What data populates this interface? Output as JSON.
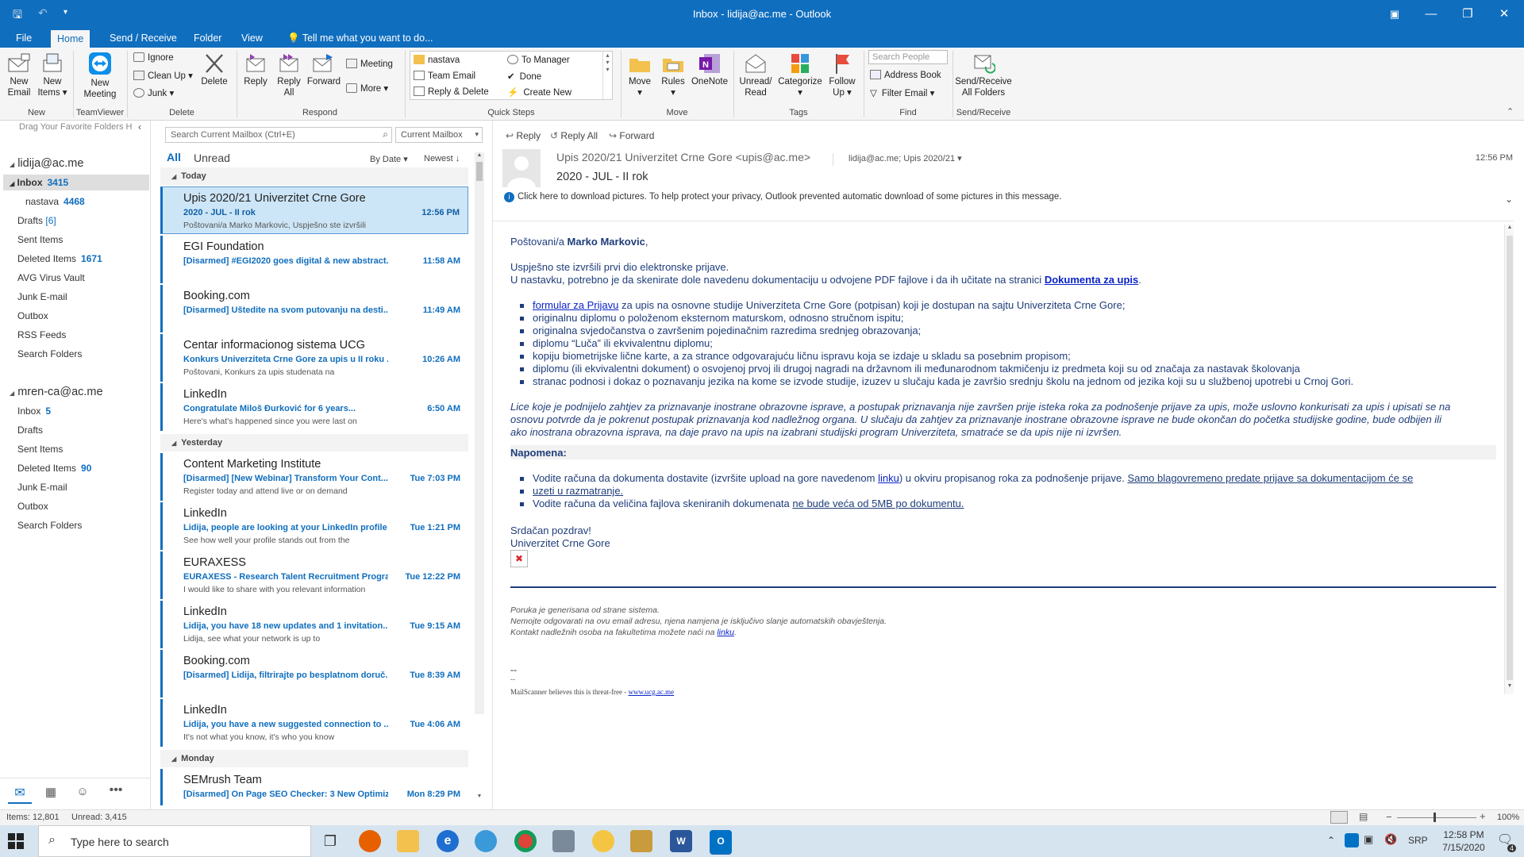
{
  "window": {
    "title": "Inbox - lidija@ac.me - Outlook"
  },
  "tabs": [
    {
      "label": "File"
    },
    {
      "label": "Home"
    },
    {
      "label": "Send / Receive"
    },
    {
      "label": "Folder"
    },
    {
      "label": "View"
    },
    {
      "label": "Tell me what you want to do..."
    }
  ],
  "ribbon": {
    "new_email": "New Email",
    "new_email_l1": "New",
    "new_email_l2": "Email",
    "new_items_l1": "New",
    "new_items_l2": "Items",
    "new_meeting_l1": "New",
    "new_meeting_l2": "Meeting",
    "group_new": "New",
    "group_teamviewer": "TeamViewer",
    "ignore": "Ignore",
    "clean_up": "Clean Up",
    "junk": "Junk",
    "delete": "Delete",
    "group_delete": "Delete",
    "reply": "Reply",
    "reply_all_l1": "Reply",
    "reply_all_l2": "All",
    "forward": "Forward",
    "meeting": "Meeting",
    "more": "More",
    "group_respond": "Respond",
    "qs_nastava": "nastava",
    "qs_team_email": "Team Email",
    "qs_reply_delete": "Reply & Delete",
    "qs_to_manager": "To Manager",
    "qs_done": "Done",
    "qs_create_new": "Create New",
    "group_quick_steps": "Quick Steps",
    "move": "Move",
    "rules": "Rules",
    "onenote": "OneNote",
    "group_move": "Move",
    "unread_l1": "Unread/",
    "unread_l2": "Read",
    "categorize": "Categorize",
    "follow_l1": "Follow",
    "follow_l2": "Up",
    "group_tags": "Tags",
    "search_people": "Search People",
    "address_book": "Address Book",
    "filter_email": "Filter Email",
    "group_find": "Find",
    "sr_l1": "Send/Receive",
    "sr_l2": "All Folders",
    "group_send_receive": "Send/Receive"
  },
  "nav": {
    "drag_hint": "Drag Your Favorite Folders H",
    "account1": "lidija@ac.me",
    "account1_folders": [
      {
        "name": "Inbox",
        "count": "3415"
      },
      {
        "name": "nastava",
        "count": "4468"
      },
      {
        "name": "Drafts",
        "count": "[6]"
      },
      {
        "name": "Sent Items",
        "count": ""
      },
      {
        "name": "Deleted Items",
        "count": "1671"
      },
      {
        "name": "AVG Virus Vault",
        "count": ""
      },
      {
        "name": "Junk E-mail",
        "count": ""
      },
      {
        "name": "Outbox",
        "count": ""
      },
      {
        "name": "RSS Feeds",
        "count": ""
      },
      {
        "name": "Search Folders",
        "count": ""
      }
    ],
    "account2": "mren-ca@ac.me",
    "account2_folders": [
      {
        "name": "Inbox",
        "count": "5"
      },
      {
        "name": "Drafts",
        "count": ""
      },
      {
        "name": "Sent Items",
        "count": ""
      },
      {
        "name": "Deleted Items",
        "count": "90"
      },
      {
        "name": "Junk E-mail",
        "count": ""
      },
      {
        "name": "Outbox",
        "count": ""
      },
      {
        "name": "Search Folders",
        "count": ""
      }
    ]
  },
  "list": {
    "search_placeholder": "Search Current Mailbox (Ctrl+E)",
    "scope": "Current Mailbox",
    "filter_all": "All",
    "filter_unread": "Unread",
    "sort_by": "By Date",
    "sort_order": "Newest",
    "group_today": "Today",
    "group_yesterday": "Yesterday",
    "group_monday": "Monday",
    "messages": [
      {
        "from": "Upis 2020/21 Univerzitet Crne Gore",
        "subject": "2020 - JUL - II rok",
        "time": "12:56 PM",
        "preview": "Poštovani/a Marko Markovic,  Uspješno ste izvršili"
      },
      {
        "from": "EGI Foundation",
        "subject": "[Disarmed] #EGI2020 goes digital & new abstract...",
        "time": "11:58 AM",
        "preview": ""
      },
      {
        "from": "Booking.com",
        "subject": "[Disarmed] Uštedite na svom putovanju na desti...",
        "time": "11:49 AM",
        "preview": ""
      },
      {
        "from": "Centar informacionog sistema UCG",
        "subject": "Konkurs Univerziteta Crne Gore za upis u II roku ...",
        "time": "10:26 AM",
        "preview": "Poštovani,   Konkurs za upis studenata na"
      },
      {
        "from": "LinkedIn",
        "subject": "Congratulate Miloš Đurković for 6 years...",
        "time": "6:50 AM",
        "preview": "Here's what's happened since you were last on"
      },
      {
        "from": "Content Marketing Institute",
        "subject": "[Disarmed] [New Webinar] Transform Your Cont...",
        "time": "Tue 7:03 PM",
        "preview": "Register today and attend live or on demand"
      },
      {
        "from": "LinkedIn",
        "subject": "Lidija, people are looking at your LinkedIn profile",
        "time": "Tue 1:21 PM",
        "preview": "See how well your profile stands out from the"
      },
      {
        "from": "EURAXESS",
        "subject": "EURAXESS - Research Talent Recruitment Progra...",
        "time": "Tue 12:22 PM",
        "preview": "I would like to share with you relevant information"
      },
      {
        "from": "LinkedIn",
        "subject": "Lidija, you have 18 new updates and 1 invitation...",
        "time": "Tue 9:15 AM",
        "preview": "Lidija, see what your network is up to"
      },
      {
        "from": "Booking.com",
        "subject": "[Disarmed] Lidija, filtrirajte po besplatnom doruč...",
        "time": "Tue 8:39 AM",
        "preview": ""
      },
      {
        "from": "LinkedIn",
        "subject": "Lidija, you have a new suggested connection to ...",
        "time": "Tue 4:06 AM",
        "preview": "It's not what you know, it's who you know"
      },
      {
        "from": "SEMrush Team",
        "subject": "[Disarmed] On Page SEO Checker: 3 New Optimiz...",
        "time": "Mon 8:29 PM",
        "preview": ""
      }
    ]
  },
  "reading": {
    "reply": "Reply",
    "reply_all": "Reply All",
    "forward": "Forward",
    "sender": "Upis 2020/21 Univerzitet Crne Gore <upis@ac.me>",
    "recipients": "lidija@ac.me; Upis 2020/21",
    "time": "12:56 PM",
    "subject": "2020 - JUL - II rok",
    "info_bar": "Click here to download pictures. To help protect your privacy, Outlook prevented automatic download of some pictures in this message.",
    "greeting_pre": "Poštovani/a ",
    "greeting_name": "Marko Markovic",
    "greeting_post": ",",
    "p1": "Uspješno ste izvršili prvi dio elektronske prijave.",
    "p2_pre": "U nastavku, potrebno je da skenirate dole navedenu dokumentaciju u odvojene PDF fajlove i da ih učitate na stranici ",
    "p2_link": "Dokumenta za upis",
    "p2_post": ".",
    "b1_link": "formular za Prijavu",
    "b1_text": " za upis na osnovne studije Univerziteta Crne Gore (potpisan) koji je dostupan na sajtu Univerziteta Crne Gore;",
    "b2": "originalnu diplomu o položenom eksternom maturskom, odnosno stručnom ispitu;",
    "b3": "originalna svjedočanstva o završenim pojedinačnim razredima srednjeg obrazovanja;",
    "b4": "diplomu “Luča” ili ekvivalentnu diplomu;",
    "b5": "kopiju biometrijske lične karte, a za strance odgovarajuću ličnu ispravu koja se izdaje u skladu sa posebnim propisom;",
    "b6": "diplomu (ili ekvivalentni dokument) o osvojenoj prvoj ili drugoj nagradi na državnom ili međunarodnom takmičenju iz predmeta koji su od značaja za nastavak školovanja",
    "b7": "stranac podnosi i dokaz o poznavanju jezika na kome se izvode studije, izuzev u slučaju kada je završio srednju školu na jednom od jezika koji su u službenoj upotrebi u Crnoj Gori.",
    "i1": "Lice koje je podnijelo zahtjev za priznavanje inostrane obrazovne isprave, a postupak priznavanja nije završen prije isteka roka za podnošenje prijave za upis, može uslovno konkurisati za upis i upisati se na",
    "i2": "osnovu potvrde da je pokrenut postupak priznavanja kod nadležnog organa. U slučaju da zahtjev za priznavanje inostrane obrazovne isprave ne bude okončan do početka studijske godine, bude odbijen ili",
    "i3": "ako inostrana obrazovna isprava, na daje pravo na upis na izabrani studijski program Univerziteta, smatraće se da upis nije ni izvršen.",
    "napomena": "Napomena:",
    "n1_pre": "Vodite računa da dokumenta dostavite (izvršite upload na gore navedenom ",
    "n1_link": "linku",
    "n1_mid": ") u okviru propisanog roka za podnošenje prijave. ",
    "n1_u1": "Samo blagovremeno predate prijave sa dokumentacijom će se",
    "n1_u2": "uzeti u razmatranje.",
    "n2_pre": "Vodite računa da veličina fajlova skeniranih dokumenata ",
    "n2_u": "ne bude veća od 5MB po dokumentu.",
    "closing1": "Srdačan pozdrav!",
    "closing2": "Univerzitet Crne Gore",
    "f1": "Poruka je generisana od strane sistema.",
    "f2": "Nemojte odgovarati na ovu email adresu, njena namjena je isključivo slanje automatskih obavještenja.",
    "f3_pre": "Kontakt nadležnih osoba na fakultetima možete naći na ",
    "f3_link": "linku",
    "f3_post": ".",
    "sig1": "--",
    "sig2": "--",
    "mailscanner_pre": "MailScanner believes this is threat-free - ",
    "mailscanner_link": "www.ucg.ac.me"
  },
  "status": {
    "items": "Items: 12,801",
    "unread": "Unread: 3,415",
    "zoom": "100%"
  },
  "taskbar": {
    "search_placeholder": "Type here to search",
    "lang": "SRP",
    "time": "12:58 PM",
    "date": "7/15/2020",
    "notif_count": "4"
  },
  "colors": {
    "accent": "#106ebe",
    "selected": "#cde6f7",
    "body_text": "#1f3d7a"
  }
}
